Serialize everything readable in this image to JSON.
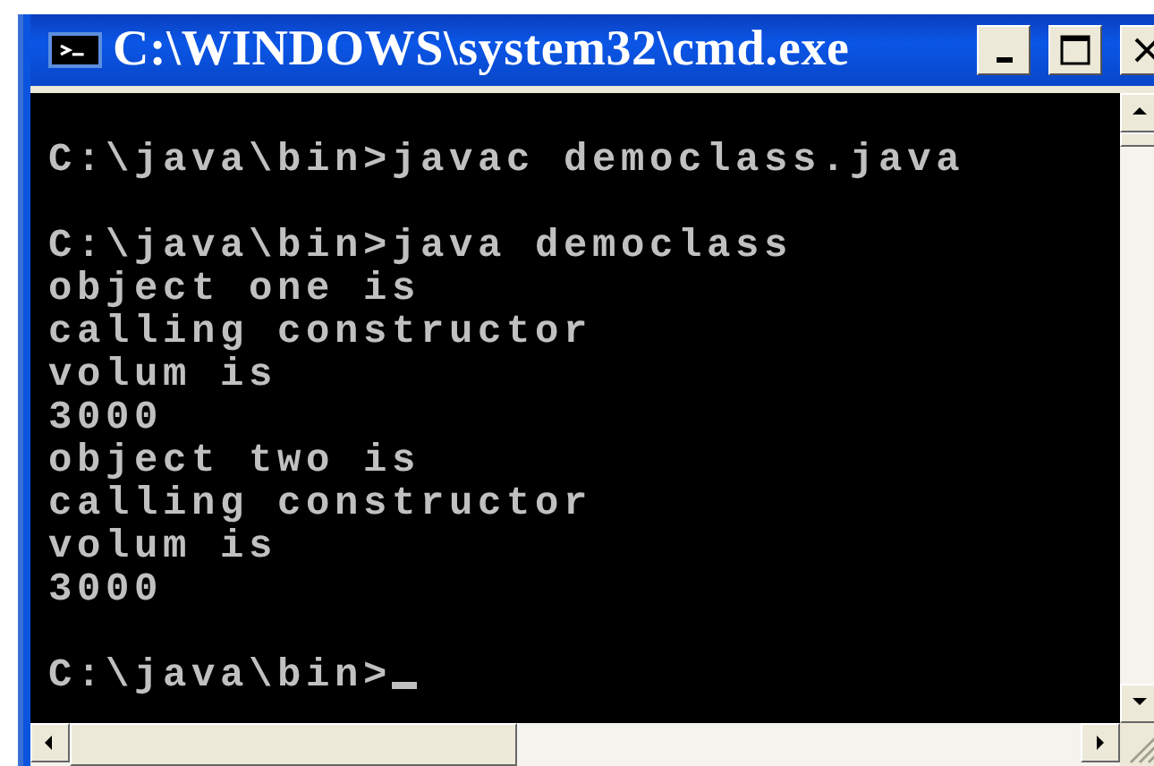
{
  "window": {
    "title": "C:\\WINDOWS\\system32\\cmd.exe"
  },
  "console": {
    "blocks": [
      {
        "lines": [
          "C:\\java\\bin>javac democlass.java"
        ]
      },
      {
        "lines": [
          "C:\\java\\bin>java democlass",
          "object one is",
          "calling constructor",
          "volum is",
          "3000",
          "object two is",
          "calling constructor",
          "volum is",
          "3000"
        ]
      },
      {
        "lines": [
          "C:\\java\\bin>"
        ]
      }
    ]
  }
}
